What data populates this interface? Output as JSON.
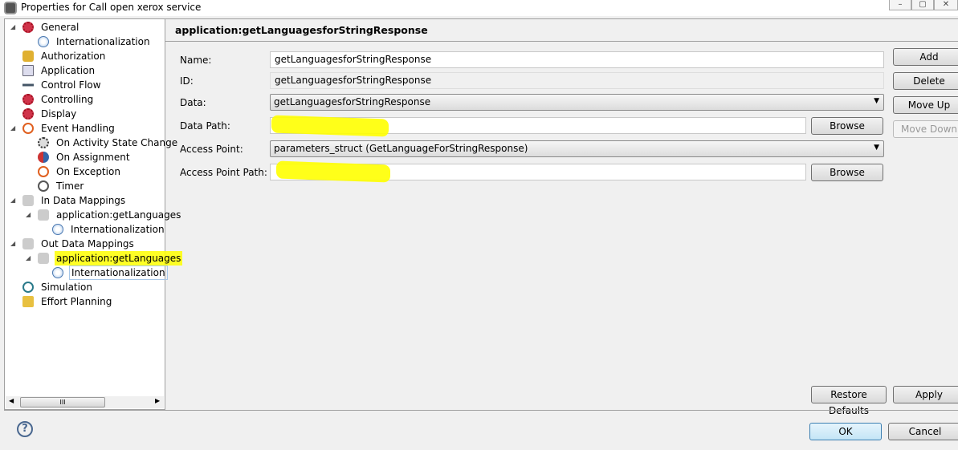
{
  "window": {
    "title": "Properties for Call open xerox service",
    "controls": [
      "minimize",
      "maximize",
      "close"
    ]
  },
  "tree": [
    {
      "label": "General",
      "level": 0,
      "expanded": true,
      "icon": "gear-icon"
    },
    {
      "label": "Internationalization",
      "level": 1,
      "icon": "globe-icon"
    },
    {
      "label": "Authorization",
      "level": 0,
      "icon": "key-icon"
    },
    {
      "label": "Application",
      "level": 0,
      "icon": "application-icon"
    },
    {
      "label": "Control Flow",
      "level": 0,
      "icon": "control-flow-icon"
    },
    {
      "label": "Controlling",
      "level": 0,
      "icon": "gear-icon"
    },
    {
      "label": "Display",
      "level": 0,
      "icon": "gear-icon"
    },
    {
      "label": "Event Handling",
      "level": 0,
      "expanded": true,
      "icon": "warning-icon"
    },
    {
      "label": "On Activity State Change",
      "level": 1,
      "icon": "state-change-icon"
    },
    {
      "label": "On Assignment",
      "level": 1,
      "icon": "assignment-icon"
    },
    {
      "label": "On Exception",
      "level": 1,
      "icon": "exception-icon"
    },
    {
      "label": "Timer",
      "level": 1,
      "icon": "timer-icon"
    },
    {
      "label": "In Data Mappings",
      "level": 0,
      "expanded": true,
      "icon": "in-data-mapping-icon"
    },
    {
      "label": "application:getLanguages",
      "level": 1,
      "expanded": true,
      "icon": "in-data-mapping-icon"
    },
    {
      "label": "Internationalization",
      "level": 2,
      "icon": "globe-icon"
    },
    {
      "label": "Out Data Mappings",
      "level": 0,
      "expanded": true,
      "icon": "out-data-mapping-icon"
    },
    {
      "label": "application:getLanguages",
      "level": 1,
      "expanded": true,
      "icon": "out-data-mapping-icon",
      "highlighted": true
    },
    {
      "label": "Internationalization",
      "level": 2,
      "icon": "globe-icon",
      "selected": true
    },
    {
      "label": "Simulation",
      "level": 0,
      "icon": "simulation-icon"
    },
    {
      "label": "Effort Planning",
      "level": 0,
      "icon": "effort-planning-icon"
    }
  ],
  "scrollbar": {
    "thumb_label": "III"
  },
  "panel": {
    "title": "application:getLanguagesforStringResponse",
    "name_label": "Name:",
    "name_value": "getLanguagesforStringResponse",
    "id_label": "ID:",
    "id_value": "getLanguagesforStringResponse",
    "data_label": "Data:",
    "data_value": "getLanguagesforStringResponse",
    "data_path_label": "Data Path:",
    "data_path_value": "",
    "access_point_label": "Access Point:",
    "access_point_value": "parameters_struct (GetLanguageForStringResponse)",
    "access_point_path_label": "Access Point Path:",
    "access_point_path_value": "",
    "browse": "Browse"
  },
  "side_buttons": {
    "add": "Add",
    "delete": "Delete",
    "move_up": "Move Up",
    "move_down": "Move Down"
  },
  "footer": {
    "restore_defaults": "Restore Defaults",
    "apply": "Apply",
    "ok": "OK",
    "cancel": "Cancel",
    "help": "?"
  },
  "colors": {
    "highlight": "#ffff00",
    "default_button": "#3c7fb1"
  }
}
